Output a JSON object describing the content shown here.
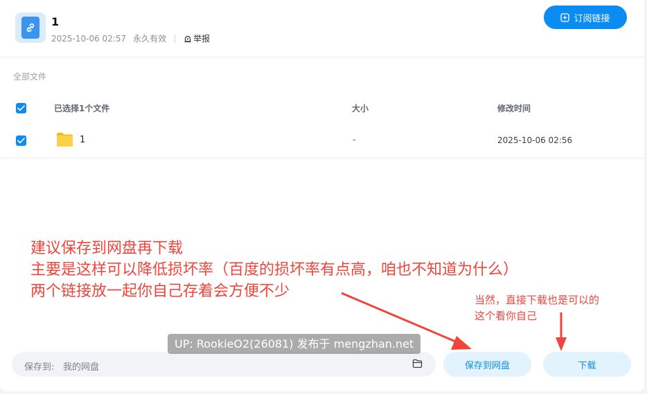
{
  "share": {
    "title": "1",
    "date": "2025-10-06 02:57",
    "validity": "永久有效",
    "report_label": "举报"
  },
  "subscribe_label": "订阅链接",
  "breadcrumb": "全部文件",
  "table": {
    "headers": [
      "已选择1个文件",
      "大小",
      "修改时间"
    ],
    "rows": [
      {
        "name": "1",
        "size": "-",
        "modified": "2025-10-06 02:56",
        "checked": true
      }
    ]
  },
  "annotation": {
    "lines": [
      "建议保存到网盘再下载",
      "主要是这样可以降低损坏率（百度的损坏率有点高，咱也不知道为什么）",
      "两个链接放一起你自己存着会方便不少"
    ],
    "side_lines": [
      "当然，直接下载也是可以的",
      "这个看你自己"
    ]
  },
  "watermark": "UP: RookieO2(26081) 发布于 mengzhan.net",
  "footer": {
    "save_to_label": "保存到:",
    "save_to_value": "我的网盘",
    "save_button": "保存到网盘",
    "download_button": "下载"
  },
  "colors": {
    "accent": "#0a8cf3",
    "annotation": "#f0453b"
  },
  "icons": [
    "link-icon",
    "report-icon",
    "subscribe-plus-icon",
    "check-icon",
    "folder-icon",
    "folder-outline-icon"
  ]
}
